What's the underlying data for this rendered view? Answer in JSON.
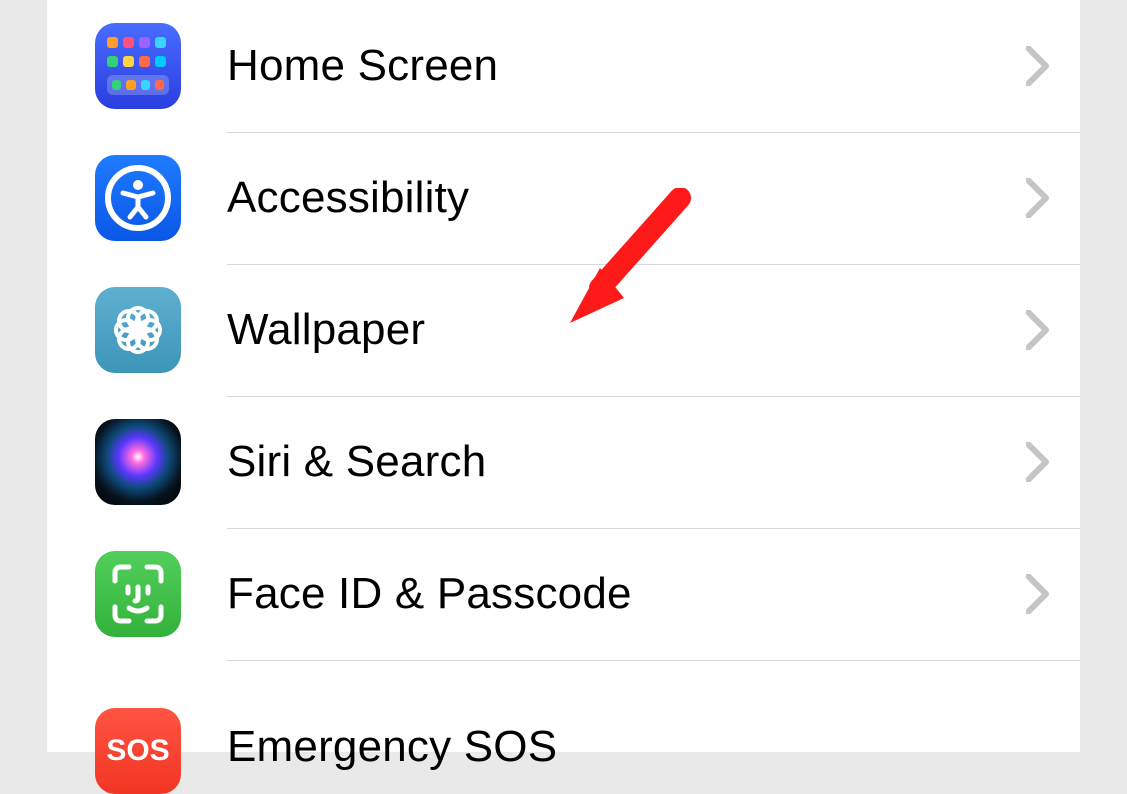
{
  "settings": {
    "items": [
      {
        "id": "home-screen",
        "label": "Home Screen"
      },
      {
        "id": "accessibility",
        "label": "Accessibility"
      },
      {
        "id": "wallpaper",
        "label": "Wallpaper"
      },
      {
        "id": "siri-search",
        "label": "Siri & Search"
      },
      {
        "id": "face-id",
        "label": "Face ID & Passcode"
      },
      {
        "id": "sos",
        "label": "Emergency SOS"
      }
    ]
  },
  "icons": {
    "sos_text": "SOS"
  },
  "annotation": {
    "target": "wallpaper"
  }
}
